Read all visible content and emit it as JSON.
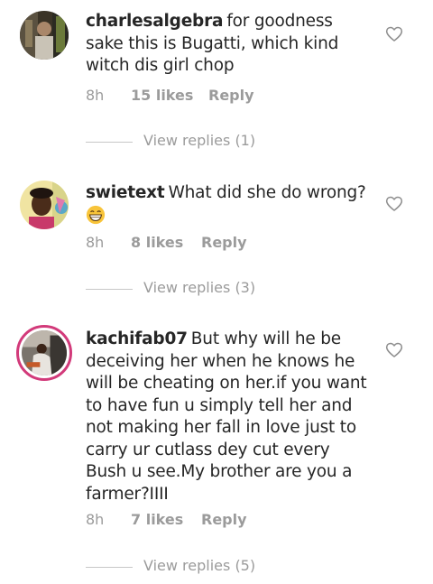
{
  "comments": [
    {
      "username": "charlesalgebra",
      "text": "for goodness sake this is Bugatti, which kind witch dis girl chop",
      "time": "8h",
      "likes": "15 likes",
      "reply": "Reply",
      "view_replies": "View replies (1)",
      "avatar_icon": "profile-photo",
      "like_icon": "heart-outline-icon"
    },
    {
      "username": "swietext",
      "text": "What did she do wrong?",
      "emoji_icon": "grinning-face-emoji",
      "time": "8h",
      "likes": "8 likes",
      "reply": "Reply",
      "view_replies": "View replies (3)",
      "avatar_icon": "profile-photo",
      "like_icon": "heart-outline-icon"
    },
    {
      "username": "kachifab07",
      "text": "But why will he be deceiving her when he knows he will be cheating on her.if you want to have fun u simply tell her and not making her fall in love just to carry ur cutlass dey cut every Bush u see.My brother are you a farmer?IIII",
      "time": "8h",
      "likes": "7 likes",
      "reply": "Reply",
      "view_replies": "View replies (5)",
      "avatar_icon": "profile-photo-with-story-ring",
      "like_icon": "heart-outline-icon"
    }
  ],
  "colors": {
    "text": "#262626",
    "meta": "#9b9b9b",
    "story_ring": "#d23a7a"
  }
}
